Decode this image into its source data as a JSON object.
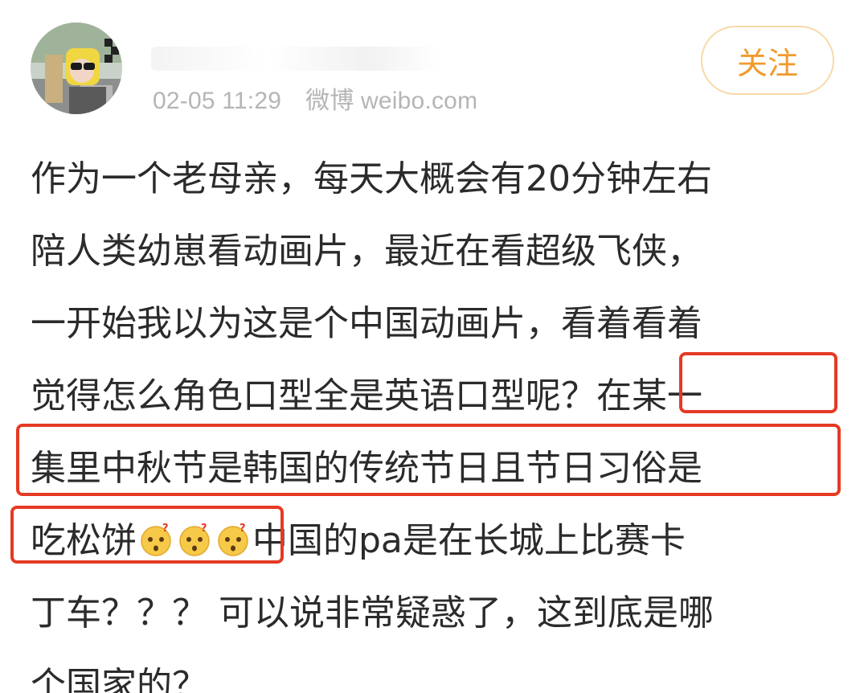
{
  "post": {
    "avatar_icon": "user-avatar",
    "timestamp": "02-05 11:29",
    "source": "微博 weibo.com",
    "follow_label": "关注",
    "colors": {
      "accent": "#f19a2c",
      "follow_border": "#f8d9a8",
      "highlight": "#e53a24",
      "meta_text": "#b5b5b5"
    },
    "lines": [
      "作为一个老母亲，每天大概会有20分钟左右",
      "陪人类幼崽看动画片，最近在看超级飞侠，",
      "一开始我以为这是个中国动画片，看着看着",
      "觉得怎么角色口型全是英语口型呢？在某一",
      "集里中秋节是韩国的传统节日且节日习俗是",
      "",
      "丁车？？？ 可以说非常疑惑了，这到底是哪",
      "个国家的？"
    ],
    "line6": {
      "before": "吃松饼",
      "emoji_name": "doubt-face-emoji",
      "emoji_count": 3,
      "after": "中国的pa是在长城上比赛卡"
    }
  }
}
